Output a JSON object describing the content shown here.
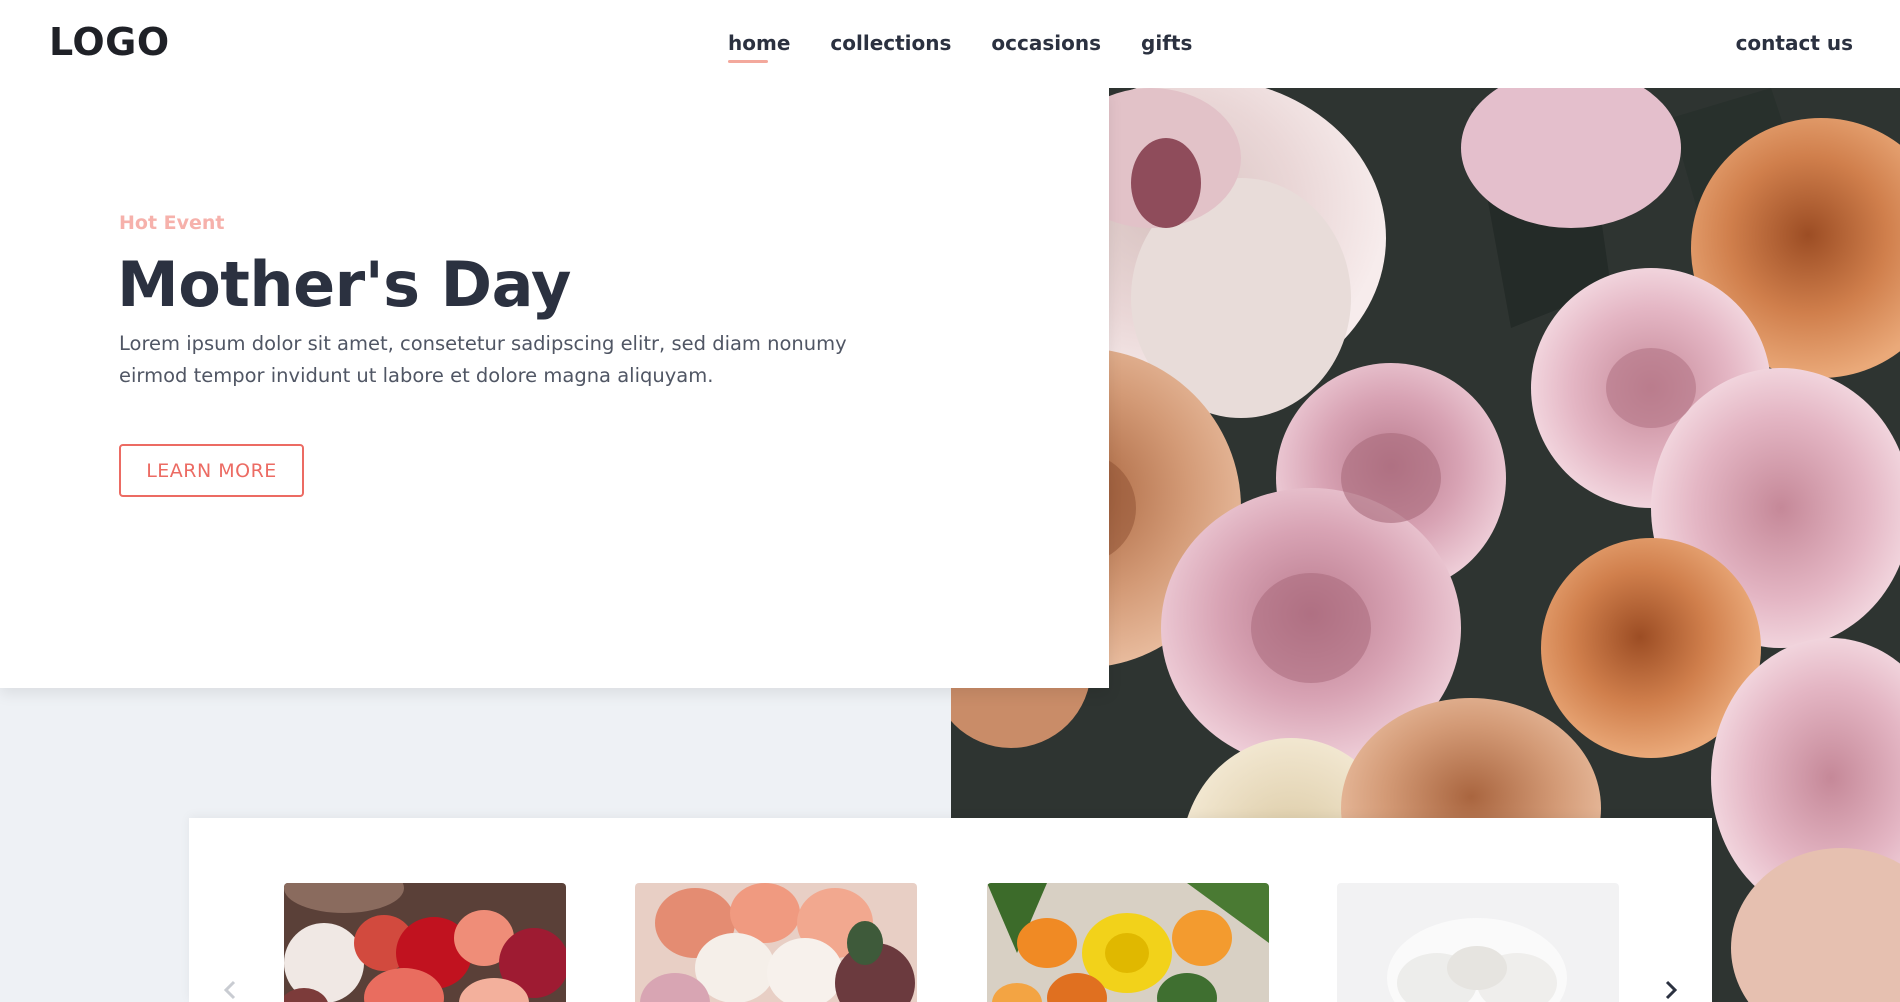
{
  "header": {
    "logo": "LOGO",
    "nav": [
      {
        "label": "home",
        "active": true
      },
      {
        "label": "collections",
        "active": false
      },
      {
        "label": "occasions",
        "active": false
      },
      {
        "label": "gifts",
        "active": false
      }
    ],
    "contact": "contact us"
  },
  "hero": {
    "eyebrow": "Hot Event",
    "title": "Mother's Day",
    "description": "Lorem ipsum dolor sit amet, consetetur sadipscing elitr, sed diam nonumy eirmod tempor invidunt ut labore et dolore magna aliquyam.",
    "button": "LEARN MORE",
    "image": "peony-bouquet-photo"
  },
  "products": {
    "items": [
      {
        "image": "red-rose-bouquet-photo"
      },
      {
        "image": "peach-ranunculus-bouquet-photo"
      },
      {
        "image": "yellow-chrysanthemum-bouquet-photo"
      },
      {
        "image": "white-peony-bouquet-photo"
      }
    ],
    "prev_icon": "chevron-left-icon",
    "next_icon": "chevron-right-icon"
  },
  "colors": {
    "accent": "#ec6b63",
    "eyebrow": "#f6b1ab",
    "text_dark": "#2b3140",
    "background": "#eef1f5"
  }
}
